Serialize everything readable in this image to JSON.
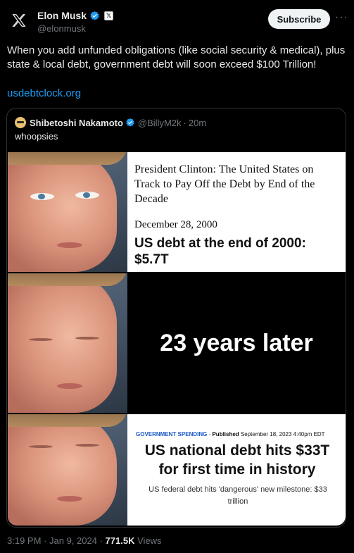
{
  "tweet": {
    "author_name": "Elon Musk",
    "author_handle": "@elonmusk",
    "subscribe_label": "Subscribe",
    "more_icon": "more-icon",
    "text": "When you add unfunded obligations (like social security & medical), plus state & local debt, government debt will soon exceed $100 Trillion!",
    "link": "usdebtclock.org",
    "time": "3:19 PM",
    "date": "Jan 9, 2024",
    "views_count": "771.5K",
    "views_label": "Views"
  },
  "quote": {
    "author_name": "Shibetoshi Nakamoto",
    "author_handle": "@BillyM2k",
    "age": "20m",
    "text": "whoopsies",
    "meme": {
      "panel1": {
        "headline": "President Clinton: The United States on Track to Pay Off the Debt by End of the Decade",
        "date": "December 28, 2000",
        "debt": "US debt at the end of 2000: $5.7T"
      },
      "panel2": {
        "text": "23 years later"
      },
      "panel3": {
        "section": "GOVERNMENT SPENDING",
        "published": "Published",
        "published_date": "September 18, 2023 4:40pm EDT",
        "headline": "US national debt hits $33T for first time in history",
        "subtitle": "US federal debt hits 'dangerous' new milestone: $33 trillion"
      }
    }
  },
  "colors": {
    "background": "#000000",
    "text": "#e7e9ea",
    "muted": "#71767b",
    "link": "#1d9bf0",
    "verified": "#1d9bf0",
    "border": "#2f3336"
  }
}
